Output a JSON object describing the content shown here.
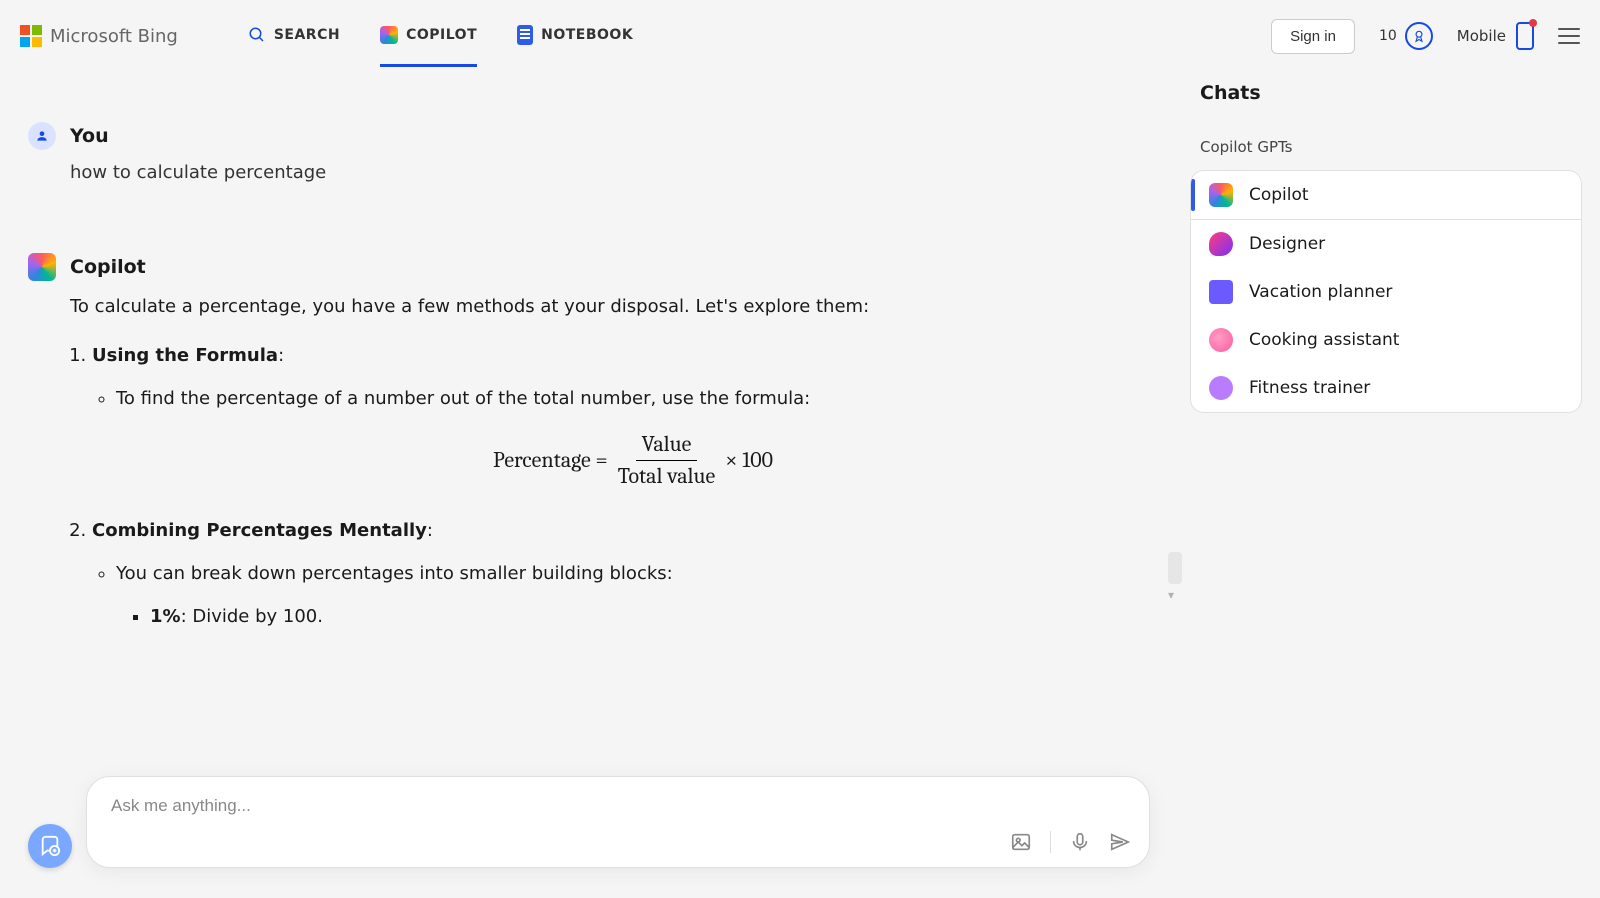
{
  "header": {
    "brand": "Microsoft Bing",
    "tabs": {
      "search": "SEARCH",
      "copilot": "COPILOT",
      "notebook": "NOTEBOOK"
    },
    "signin": "Sign in",
    "rewards_points": "10",
    "mobile": "Mobile"
  },
  "chat": {
    "user_label": "You",
    "user_msg": "how to calculate percentage",
    "copilot_label": "Copilot",
    "intro": "To calculate a percentage, you have a few methods at your disposal. Let's explore them:",
    "item1_title": "Using the Formula",
    "item1_bullet": "To find the percentage of a number out of the total number, use the formula:",
    "formula_lhs": "Percentage =",
    "formula_num": "Value",
    "formula_den": "Total value",
    "formula_rhs": "× 100",
    "item2_title": "Combining Percentages Mentally",
    "item2_bullet": "You can break down percentages into smaller building blocks:",
    "sub_1pct_label": "1%",
    "sub_1pct_text": ": Divide by 100."
  },
  "input": {
    "placeholder": "Ask me anything..."
  },
  "sidebar": {
    "title": "Chats",
    "section": "Copilot GPTs",
    "items": [
      {
        "label": "Copilot",
        "icon": "copilot",
        "active": true
      },
      {
        "label": "Designer",
        "icon": "designer",
        "active": false
      },
      {
        "label": "Vacation planner",
        "icon": "vacation",
        "active": false
      },
      {
        "label": "Cooking assistant",
        "icon": "cooking",
        "active": false
      },
      {
        "label": "Fitness trainer",
        "icon": "fitness",
        "active": false
      }
    ]
  }
}
